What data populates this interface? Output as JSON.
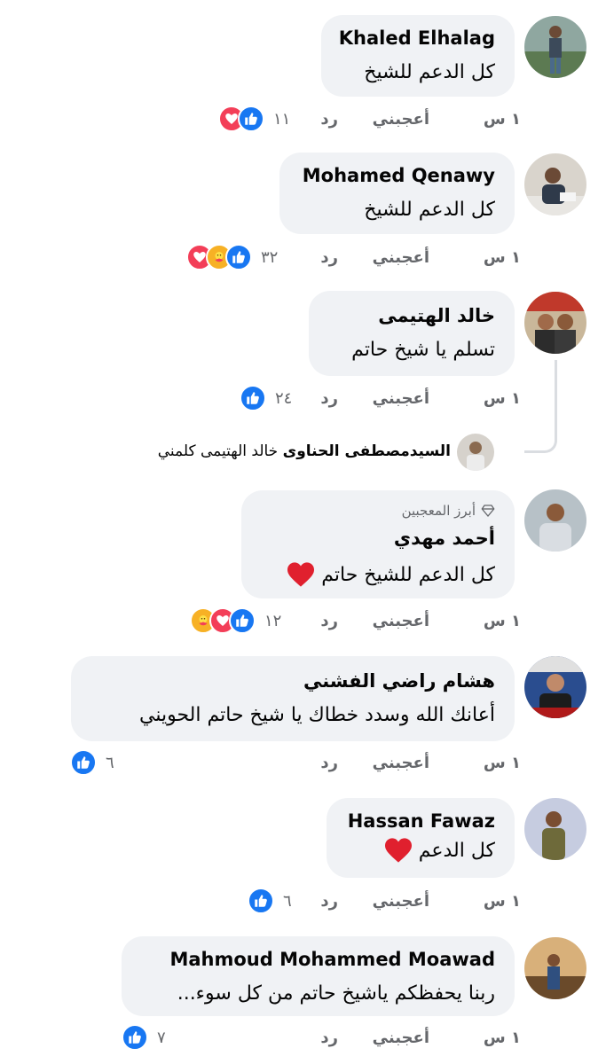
{
  "actions": {
    "time": "١ س",
    "like": "أعجبني",
    "reply": "رد"
  },
  "top_fan_label": "أبرز المعجبين",
  "comments": [
    {
      "name": "Khaled Elhalag",
      "text": "كل الدعم للشيخ",
      "count": "١١",
      "reactions": [
        "like-icon",
        "love-icon"
      ]
    },
    {
      "name": "Mohamed Qenawy",
      "text": "كل الدعم للشيخ",
      "count": "٣٢",
      "reactions": [
        "like-icon",
        "care-icon",
        "love-icon"
      ]
    },
    {
      "name": "خالد الهتيمى",
      "text": "تسلم يا شيخ حاتم",
      "count": "٢٤",
      "reactions": [
        "like-icon"
      ]
    },
    {
      "name": "أحمد مهدي",
      "text": "كل الدعم للشيخ حاتم",
      "count": "١٢",
      "reactions": [
        "like-icon",
        "love-icon",
        "care-icon"
      ],
      "badge": "top-fan",
      "emoji": "heart"
    },
    {
      "name": "هشام راضي الفشني",
      "text": "أعانك الله وسدد خطاك يا شيخ حاتم الحويني",
      "count": "٦",
      "reactions": [
        "like-icon"
      ]
    },
    {
      "name": "Hassan Fawaz",
      "text": "كل الدعم",
      "count": "٦",
      "reactions": [
        "like-icon"
      ],
      "emoji": "heart"
    },
    {
      "name": "Mahmoud Mohammed Moawad",
      "text": "ربنا يحفظكم ياشيخ حاتم من كل سوء...",
      "count": "٧",
      "reactions": [
        "like-icon"
      ]
    }
  ],
  "reply_preview": {
    "name": "السيدمصطفى الحناوى",
    "text": "خالد الهتيمى كلمني"
  },
  "colors": {
    "bubble": "#f0f2f5",
    "like": "#1877f2",
    "love": "#f33e58",
    "care": "#f7b125",
    "muted": "#65676b"
  }
}
